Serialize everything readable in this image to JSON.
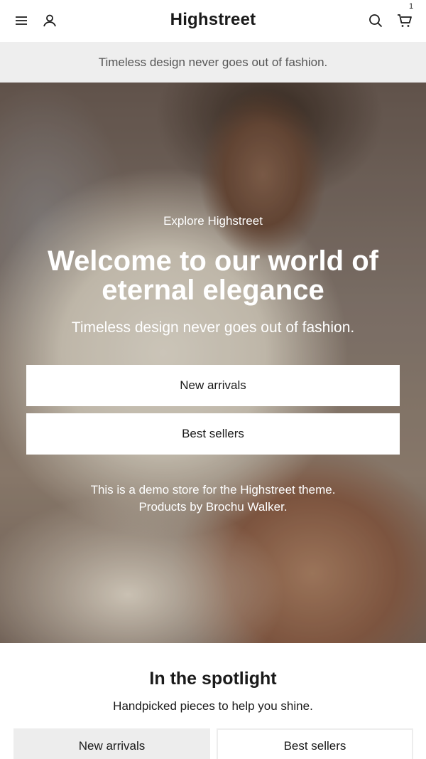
{
  "header": {
    "logo": "Highstreet",
    "cart_count": "1",
    "icons": [
      "menu-icon",
      "account-icon",
      "search-icon",
      "cart-icon"
    ]
  },
  "announcement": {
    "text": "Timeless design never goes out of fashion."
  },
  "hero": {
    "kicker": "Explore Highstreet",
    "title": "Welcome to our world of eternal elegance",
    "subtitle": "Timeless design never goes out of fashion.",
    "buttons": [
      {
        "label": "New arrivals"
      },
      {
        "label": "Best sellers"
      }
    ],
    "note_line1": "This is a demo store for the Highstreet theme.",
    "note_line2": "Products by Brochu Walker."
  },
  "spotlight": {
    "title": "In the spotlight",
    "subtitle": "Handpicked pieces to help you shine.",
    "tabs": [
      {
        "label": "New arrivals",
        "active": true
      },
      {
        "label": "Best sellers",
        "active": false
      }
    ]
  },
  "colors": {
    "announcement_bg": "#eeeeee",
    "text": "#1a1a1a",
    "hero_text": "#ffffff"
  }
}
